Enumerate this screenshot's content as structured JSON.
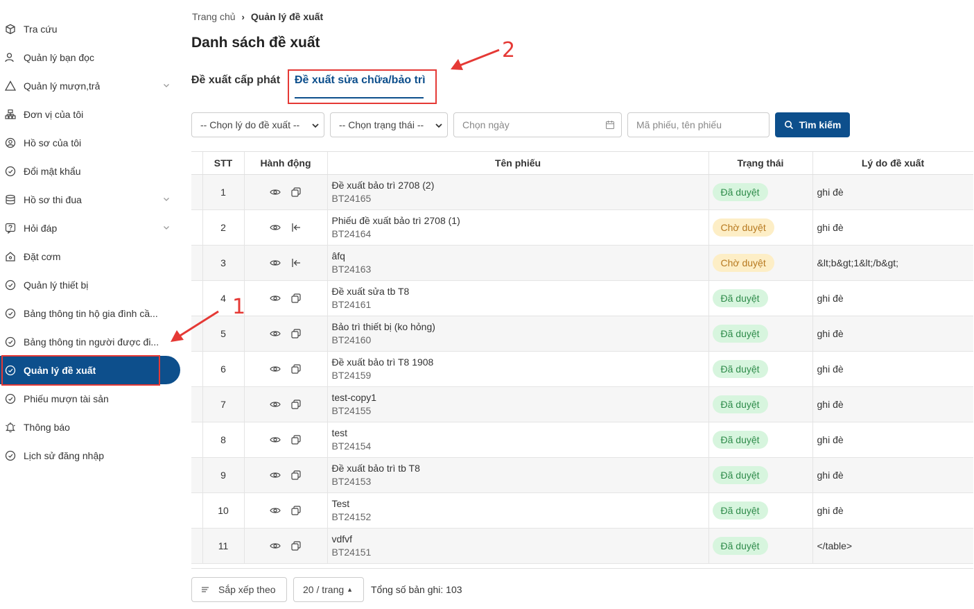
{
  "sidebar": {
    "items": [
      {
        "label": "Tra cứu",
        "icon": "box-icon",
        "chevron": false
      },
      {
        "label": "Quản lý bạn đọc",
        "icon": "user-icon",
        "chevron": false
      },
      {
        "label": "Quản lý mượn,trả",
        "icon": "warning-icon",
        "chevron": true
      },
      {
        "label": "Đơn vị của tôi",
        "icon": "org-icon",
        "chevron": false
      },
      {
        "label": "Hồ sơ của tôi",
        "icon": "user-circle-icon",
        "chevron": false
      },
      {
        "label": "Đổi mật khẩu",
        "icon": "check-circle-icon",
        "chevron": false
      },
      {
        "label": "Hồ sơ thi đua",
        "icon": "database-icon",
        "chevron": true
      },
      {
        "label": "Hỏi đáp",
        "icon": "question-icon",
        "chevron": true
      },
      {
        "label": "Đặt cơm",
        "icon": "home-icon",
        "chevron": false
      },
      {
        "label": "Quản lý thiết bị",
        "icon": "check-circle-icon",
        "chevron": false
      },
      {
        "label": "Bảng thông tin hộ gia đình cầ...",
        "icon": "check-circle-icon",
        "chevron": false
      },
      {
        "label": "Bảng thông tin người được đi...",
        "icon": "check-circle-icon",
        "chevron": false
      },
      {
        "label": "Quản lý đề xuất",
        "icon": "check-circle-icon",
        "chevron": false,
        "active": true
      },
      {
        "label": "Phiếu mượn tài sản",
        "icon": "check-circle-icon",
        "chevron": false
      },
      {
        "label": "Thông báo",
        "icon": "bell-icon",
        "chevron": false
      },
      {
        "label": "Lịch sử đăng nhập",
        "icon": "check-circle-icon",
        "chevron": false
      }
    ]
  },
  "breadcrumb": {
    "home": "Trang chủ",
    "sep": "›",
    "current": "Quản lý đề xuất"
  },
  "page_title": "Danh sách đề xuất",
  "tabs": [
    {
      "label": "Đề xuất cấp phát",
      "active": false
    },
    {
      "label": "Đề xuất sửa chữa/bảo trì",
      "active": true
    }
  ],
  "filters": {
    "reason": "-- Chọn lý do đề xuất --",
    "status": "-- Chọn trạng thái --",
    "date_placeholder": "Chọn ngày",
    "keyword_placeholder": "Mã phiếu, tên phiếu",
    "search_label": "Tìm kiếm"
  },
  "table": {
    "headers": [
      "STT",
      "Hành động",
      "Tên phiếu",
      "Trạng thái",
      "Lý do đề xuất"
    ],
    "rows": [
      {
        "stt": "1",
        "name": "Đề xuất bảo trì 2708 (2)",
        "code": "BT24165",
        "status": "Đã duyệt",
        "status_type": "ok",
        "reason": "ghi đè",
        "action2": "copy-icon"
      },
      {
        "stt": "2",
        "name": "Phiếu đề xuất bảo trì 2708 (1)",
        "code": "BT24164",
        "status": "Chờ duyệt",
        "status_type": "wait",
        "reason": "ghi đè",
        "action2": "arrow-left-bar-icon"
      },
      {
        "stt": "3",
        "name": "âfq",
        "code": "BT24163",
        "status": "Chờ duyệt",
        "status_type": "wait",
        "reason": "&lt;b&gt;1&lt;/b&gt;",
        "action2": "arrow-left-bar-icon"
      },
      {
        "stt": "4",
        "name": "Đề xuất sửa tb T8",
        "code": "BT24161",
        "status": "Đã duyệt",
        "status_type": "ok",
        "reason": "ghi đè",
        "action2": "copy-icon"
      },
      {
        "stt": "5",
        "name": "Bảo trì thiết bị (ko hỏng)",
        "code": "BT24160",
        "status": "Đã duyệt",
        "status_type": "ok",
        "reason": "ghi đè",
        "action2": "copy-icon"
      },
      {
        "stt": "6",
        "name": "Đề xuất bảo trì T8 1908",
        "code": "BT24159",
        "status": "Đã duyệt",
        "status_type": "ok",
        "reason": "ghi đè",
        "action2": "copy-icon"
      },
      {
        "stt": "7",
        "name": "test-copy1",
        "code": "BT24155",
        "status": "Đã duyệt",
        "status_type": "ok",
        "reason": "ghi đè",
        "action2": "copy-icon"
      },
      {
        "stt": "8",
        "name": "test",
        "code": "BT24154",
        "status": "Đã duyệt",
        "status_type": "ok",
        "reason": "ghi đè",
        "action2": "copy-icon"
      },
      {
        "stt": "9",
        "name": "Đề xuất bảo trì tb T8",
        "code": "BT24153",
        "status": "Đã duyệt",
        "status_type": "ok",
        "reason": "ghi đè",
        "action2": "copy-icon"
      },
      {
        "stt": "10",
        "name": "Test",
        "code": "BT24152",
        "status": "Đã duyệt",
        "status_type": "ok",
        "reason": "ghi đè",
        "action2": "copy-icon"
      },
      {
        "stt": "11",
        "name": "vdfvf",
        "code": "BT24151",
        "status": "Đã duyệt",
        "status_type": "ok",
        "reason": "</table>",
        "action2": "copy-icon"
      }
    ]
  },
  "footer": {
    "sort_label": "Sắp xếp theo",
    "page_size": "20 / trang",
    "total": "Tổng số bản ghi: 103"
  },
  "annotations": {
    "one": "1",
    "two": "2",
    "color": "#e53935"
  },
  "colors": {
    "primary": "#0d4f8c",
    "approved_bg": "#d7f5de",
    "approved_text": "#2e8b4a",
    "pending_bg": "#fdeec6",
    "pending_text": "#b7791f"
  }
}
